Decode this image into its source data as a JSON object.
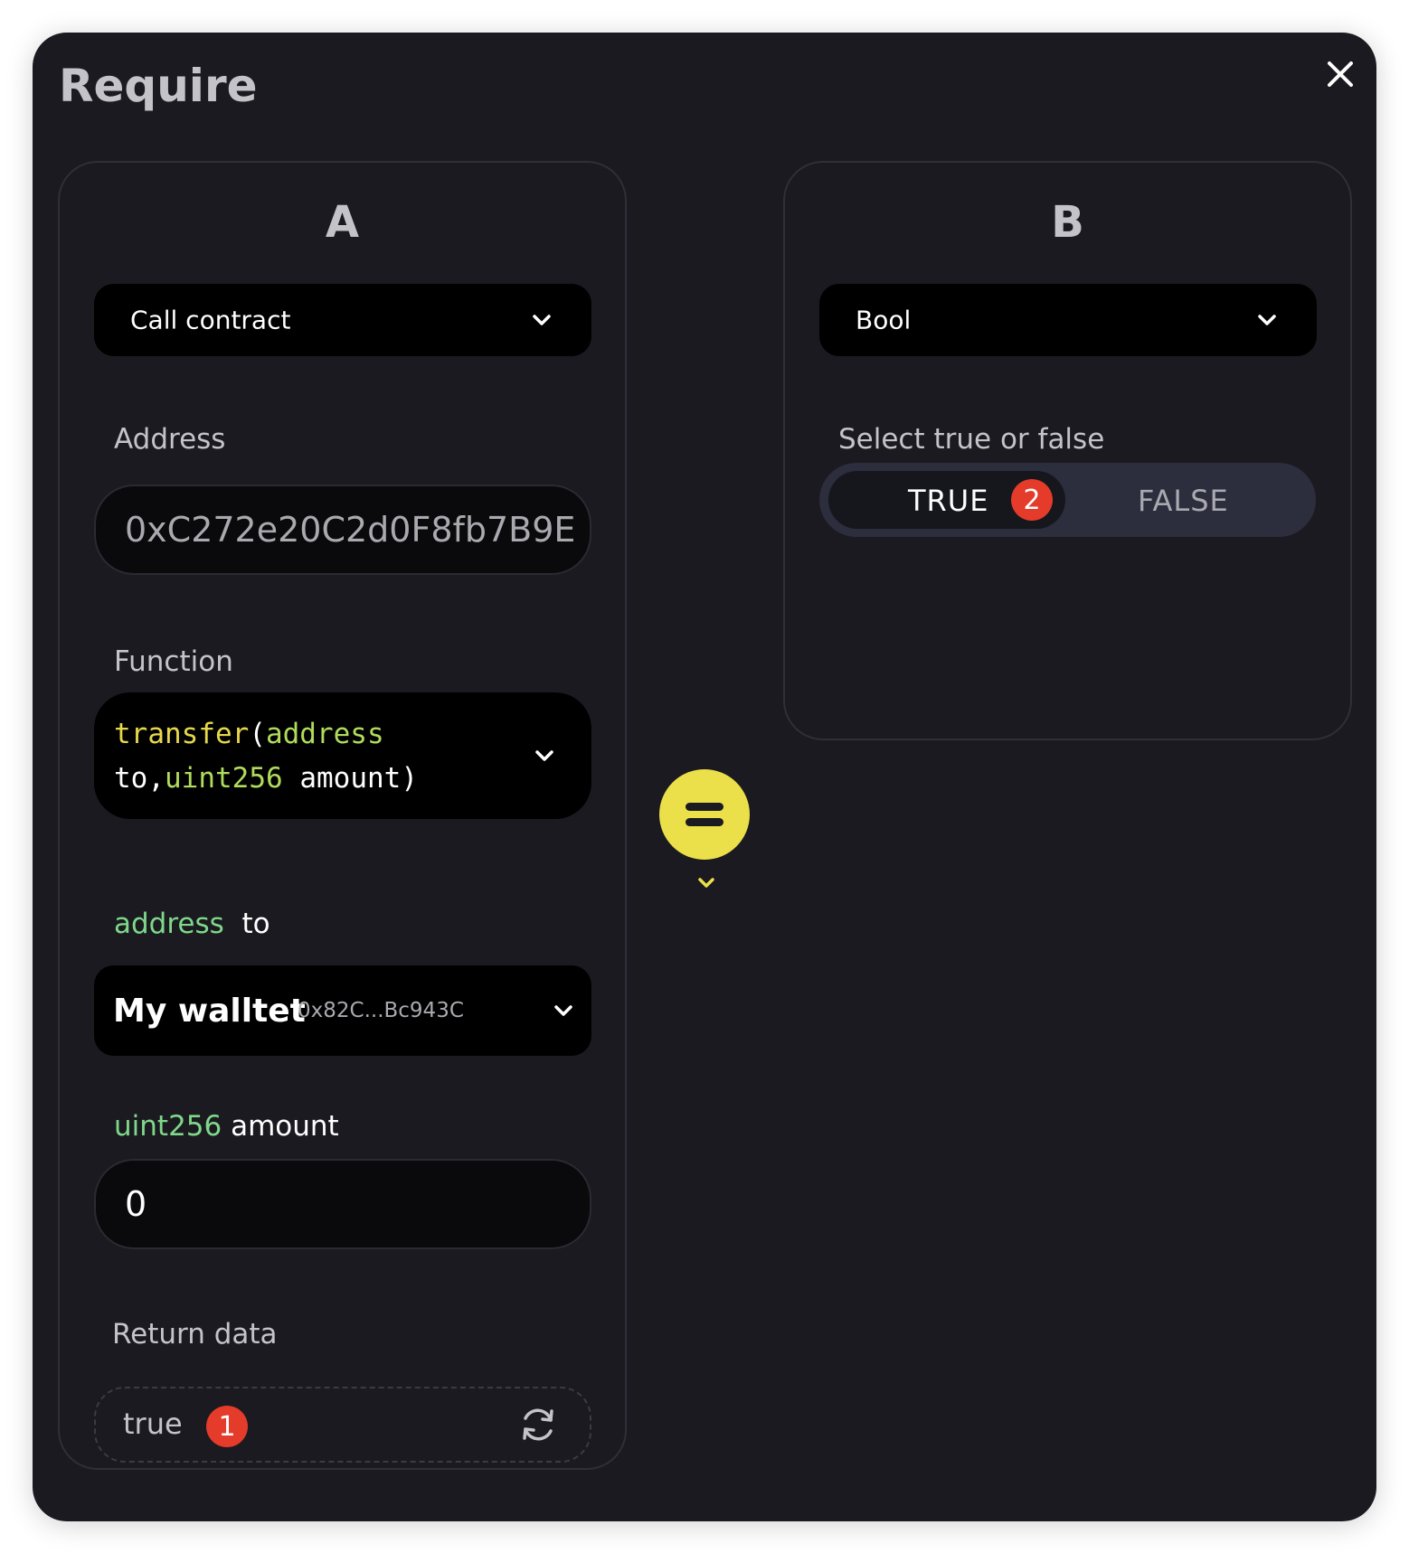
{
  "modal": {
    "title": "Require"
  },
  "panel_a": {
    "letter": "A",
    "type_select": "Call contract",
    "address_label": "Address",
    "address_value": "0xC272e20C2d0F8fb7B9E",
    "function_label": "Function",
    "function_sig": {
      "name": "transfer",
      "paren_open": "(",
      "type1": "address",
      "arg1": "to",
      "comma": ",",
      "type2": "uint256",
      "arg2": "amount",
      "paren_close": ")"
    },
    "param1": {
      "type": "address",
      "name": "to",
      "wallet_name": "My walltet",
      "wallet_address": "0x82C...Bc943C"
    },
    "param2": {
      "type": "uint256",
      "name": "amount",
      "value": "0"
    },
    "return_label": "Return data",
    "return_value": "true",
    "return_badge": "1"
  },
  "panel_b": {
    "letter": "B",
    "type_select": "Bool",
    "toggle_label": "Select true or false",
    "true_label": "TRUE",
    "false_label": "FALSE",
    "true_badge": "2",
    "selected": "TRUE"
  },
  "operator": {
    "icon": "equals-icon"
  },
  "colors": {
    "background": "#1b1a20",
    "accent_yellow": "#ebe04a",
    "badge_red": "#e43b2a",
    "type_green": "#7fd88a"
  }
}
